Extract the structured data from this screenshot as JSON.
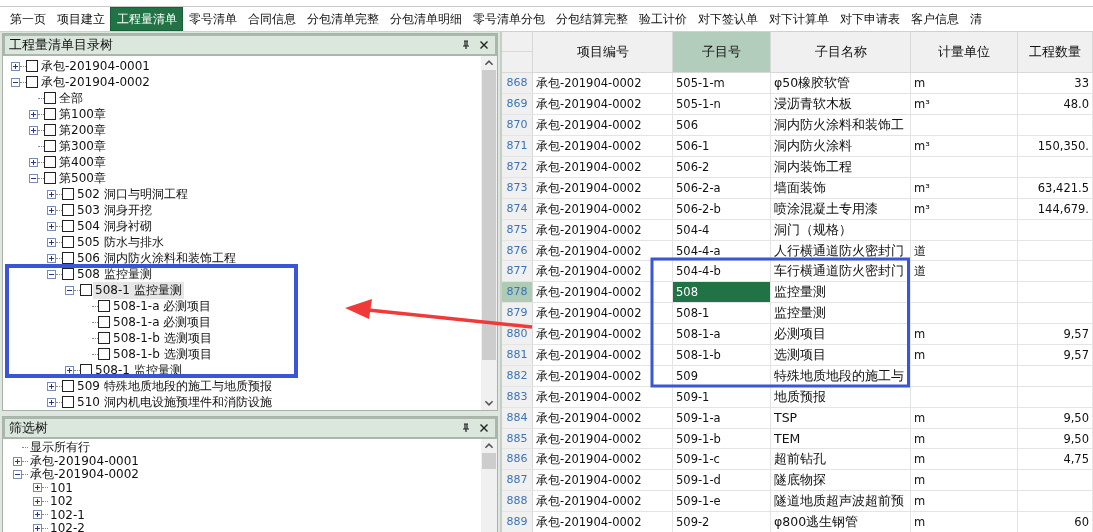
{
  "tabs": [
    {
      "label": "第一页",
      "selected": false
    },
    {
      "label": "项目建立",
      "selected": false
    },
    {
      "label": "工程量清单",
      "selected": true
    },
    {
      "label": "零号清单",
      "selected": false
    },
    {
      "label": "合同信息",
      "selected": false
    },
    {
      "label": "分包清单完整",
      "selected": false
    },
    {
      "label": "分包清单明细",
      "selected": false
    },
    {
      "label": "零号清单分包",
      "selected": false
    },
    {
      "label": "分包结算完整",
      "selected": false
    },
    {
      "label": "验工计价",
      "selected": false
    },
    {
      "label": "对下签认单",
      "selected": false
    },
    {
      "label": "对下计算单",
      "selected": false
    },
    {
      "label": "对下申请表",
      "selected": false
    },
    {
      "label": "客户信息",
      "selected": false
    },
    {
      "label": "清",
      "selected": false
    }
  ],
  "catalog_tree": {
    "title": "工程量清单目录树",
    "items": [
      {
        "label": "承包-201904-0001",
        "checked": false,
        "selected": false,
        "expanded": false
      },
      {
        "label": "承包-201904-0002",
        "checked": false,
        "selected": false,
        "expanded": true,
        "children": [
          {
            "label": "全部",
            "checked": false,
            "selected": false
          },
          {
            "label": "第100章",
            "checked": false,
            "selected": false,
            "expanded": false
          },
          {
            "label": "第200章",
            "checked": false,
            "selected": false,
            "expanded": false
          },
          {
            "label": "第300章",
            "checked": false,
            "selected": false
          },
          {
            "label": "第400章",
            "checked": false,
            "selected": false,
            "expanded": false
          },
          {
            "label": "第500章",
            "checked": false,
            "selected": false,
            "expanded": true,
            "children": [
              {
                "label": "502  洞口与明洞工程",
                "checked": false,
                "selected": false,
                "expanded": false
              },
              {
                "label": "503  洞身开挖",
                "checked": false,
                "selected": false,
                "expanded": false
              },
              {
                "label": "504  洞身衬砌",
                "checked": false,
                "selected": false,
                "expanded": false
              },
              {
                "label": "505  防水与排水",
                "checked": false,
                "selected": false,
                "expanded": false
              },
              {
                "label": "506  洞内防火涂料和装饰工程",
                "checked": false,
                "selected": false,
                "expanded": false
              },
              {
                "label": "508  监控量测",
                "checked": false,
                "selected": false,
                "expanded": true,
                "children": [
                  {
                    "label": "508-1  监控量测",
                    "checked": false,
                    "selected": true,
                    "expanded": true,
                    "children": [
                      {
                        "label": "508-1-a  必测项目",
                        "checked": false,
                        "selected": false
                      },
                      {
                        "label": "508-1-a  必测项目",
                        "checked": false,
                        "selected": false
                      },
                      {
                        "label": "508-1-b  选测项目",
                        "checked": false,
                        "selected": false
                      },
                      {
                        "label": "508-1-b  选测项目",
                        "checked": false,
                        "selected": false
                      }
                    ]
                  },
                  {
                    "label": "508-1  监控量测",
                    "checked": false,
                    "selected": false,
                    "expanded": false
                  }
                ]
              },
              {
                "label": "509  特殊地质地段的施工与地质预报",
                "checked": false,
                "selected": false,
                "expanded": false
              },
              {
                "label": "510  洞内机电设施预埋件和消防设施",
                "checked": false,
                "selected": false,
                "expanded": false
              }
            ]
          }
        ]
      }
    ]
  },
  "filter_tree": {
    "title": "筛选树",
    "items": [
      {
        "label": "显示所有行"
      },
      {
        "label": "承包-201904-0001",
        "expanded": false
      },
      {
        "label": "承包-201904-0002",
        "expanded": true,
        "children": [
          {
            "label": "101",
            "expanded": false
          },
          {
            "label": "102",
            "expanded": false
          },
          {
            "label": "102-1",
            "expanded": false
          },
          {
            "label": "102-2",
            "expanded": false
          }
        ]
      }
    ]
  },
  "table": {
    "columns": [
      {
        "label": "项目编号",
        "selected": false
      },
      {
        "label": "子目号",
        "selected": true
      },
      {
        "label": "子目名称",
        "selected": false
      },
      {
        "label": "计量单位",
        "selected": false
      },
      {
        "label": "工程数量",
        "selected": false
      }
    ],
    "rows": [
      {
        "num": "868",
        "selected": false,
        "cells": [
          "承包-201904-0002",
          "505-1-m",
          "φ50橡胶软管",
          "m",
          "33"
        ]
      },
      {
        "num": "869",
        "selected": false,
        "cells": [
          "承包-201904-0002",
          "505-1-n",
          "浸沥青软木板",
          "m³",
          "48.0"
        ]
      },
      {
        "num": "870",
        "selected": false,
        "cells": [
          "承包-201904-0002",
          "506",
          "洞内防火涂料和装饰工",
          "",
          ""
        ]
      },
      {
        "num": "871",
        "selected": false,
        "cells": [
          "承包-201904-0002",
          "506-1",
          "洞内防火涂料",
          "m³",
          "150,350."
        ]
      },
      {
        "num": "872",
        "selected": false,
        "cells": [
          "承包-201904-0002",
          "506-2",
          "洞内装饰工程",
          "",
          ""
        ]
      },
      {
        "num": "873",
        "selected": false,
        "cells": [
          "承包-201904-0002",
          "506-2-a",
          "墙面装饰",
          "m³",
          "63,421.5"
        ]
      },
      {
        "num": "874",
        "selected": false,
        "cells": [
          "承包-201904-0002",
          "506-2-b",
          "喷涂混凝土专用漆",
          "m³",
          "144,679."
        ]
      },
      {
        "num": "875",
        "selected": false,
        "cells": [
          "承包-201904-0002",
          "504-4",
          "洞门（规格）",
          "",
          ""
        ]
      },
      {
        "num": "876",
        "selected": false,
        "cells": [
          "承包-201904-0002",
          "504-4-a",
          "人行横通道防火密封门",
          "道",
          ""
        ]
      },
      {
        "num": "877",
        "selected": false,
        "cells": [
          "承包-201904-0002",
          "504-4-b",
          "车行横通道防火密封门",
          "道",
          ""
        ]
      },
      {
        "num": "878",
        "selected": true,
        "cells": [
          "承包-201904-0002",
          "508",
          "监控量测",
          "",
          ""
        ]
      },
      {
        "num": "879",
        "selected": false,
        "cells": [
          "承包-201904-0002",
          "508-1",
          "监控量测",
          "",
          ""
        ]
      },
      {
        "num": "880",
        "selected": false,
        "cells": [
          "承包-201904-0002",
          "508-1-a",
          "必测项目",
          "m",
          "9,57"
        ]
      },
      {
        "num": "881",
        "selected": false,
        "cells": [
          "承包-201904-0002",
          "508-1-b",
          "选测项目",
          "m",
          "9,57"
        ]
      },
      {
        "num": "882",
        "selected": false,
        "cells": [
          "承包-201904-0002",
          "509",
          "特殊地质地段的施工与",
          "",
          ""
        ]
      },
      {
        "num": "883",
        "selected": false,
        "cells": [
          "承包-201904-0002",
          "509-1",
          "地质预报",
          "",
          ""
        ]
      },
      {
        "num": "884",
        "selected": false,
        "cells": [
          "承包-201904-0002",
          "509-1-a",
          "TSP",
          "m",
          "9,50"
        ]
      },
      {
        "num": "885",
        "selected": false,
        "cells": [
          "承包-201904-0002",
          "509-1-b",
          "TEM",
          "m",
          "9,50"
        ]
      },
      {
        "num": "886",
        "selected": false,
        "cells": [
          "承包-201904-0002",
          "509-1-c",
          "超前钻孔",
          "m",
          "4,75"
        ]
      },
      {
        "num": "887",
        "selected": false,
        "cells": [
          "承包-201904-0002",
          "509-1-d",
          "隧底物探",
          "m",
          ""
        ]
      },
      {
        "num": "888",
        "selected": false,
        "cells": [
          "承包-201904-0002",
          "509-1-e",
          "隧道地质超声波超前预",
          "m",
          ""
        ]
      },
      {
        "num": "889",
        "selected": false,
        "cells": [
          "承包-201904-0002",
          "509-2",
          "φ800逃生钢管",
          "m",
          "60"
        ]
      }
    ]
  }
}
